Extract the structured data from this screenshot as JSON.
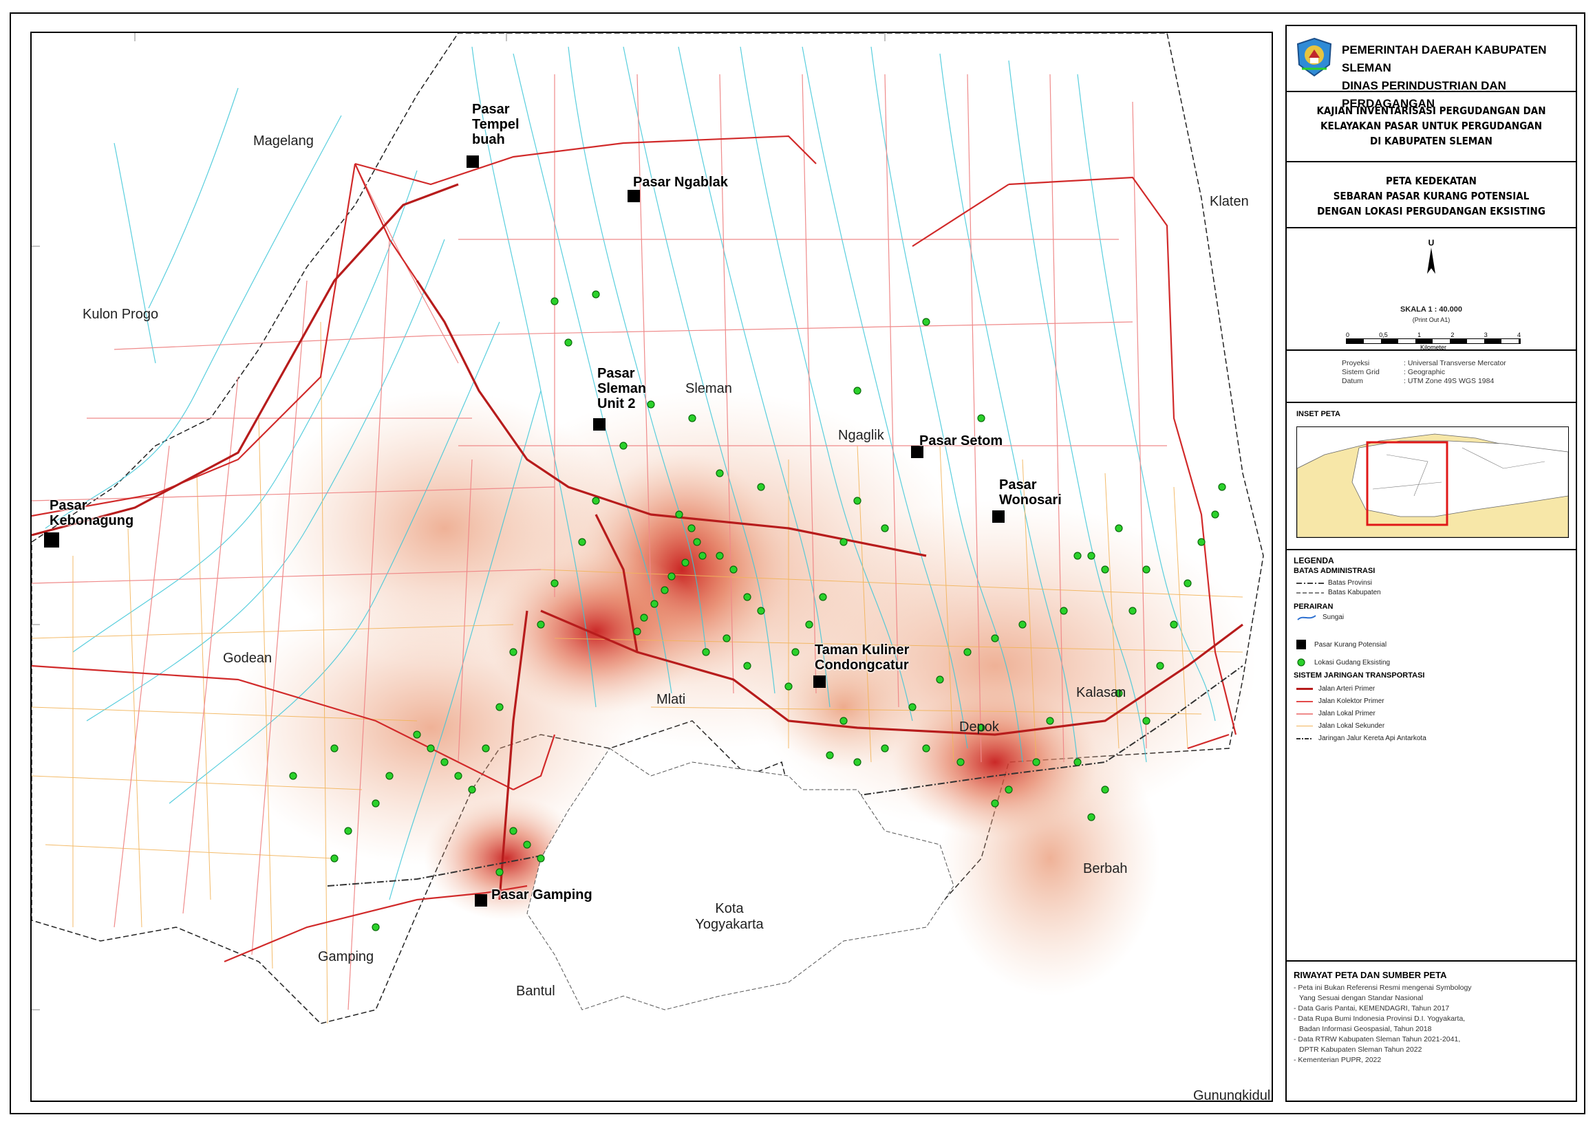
{
  "header": {
    "org_line1": "PEMERINTAH DAERAH KABUPATEN SLEMAN",
    "org_line2": "DINAS PERINDUSTRIAN DAN PERDAGANGAN",
    "study_line1": "KAJIAN INVENTARISASI PERGUDANGAN DAN",
    "study_line2": "KELAYAKAN PASAR UNTUK PERGUDANGAN",
    "study_line3": "DI KABUPATEN SLEMAN",
    "map_title1": "PETA KEDEKATAN",
    "map_title2": "SEBARAN PASAR KURANG POTENSIAL",
    "map_title3": "DENGAN LOKASI PERGUDANGAN EKSISTING"
  },
  "scale": {
    "north": "U",
    "label": "SKALA 1 : 40.000",
    "print": "(Print Out A1)",
    "ticks": [
      "0",
      "0,5",
      "1",
      "2",
      "3",
      "4"
    ],
    "unit": "Kilometer"
  },
  "projection": {
    "rows": [
      {
        "k": "Proyeksi",
        "v": ": Universal Transverse Mercator"
      },
      {
        "k": "Sistem Grid",
        "v": ": Geographic"
      },
      {
        "k": "Datum",
        "v": ": UTM Zone 49S WGS 1984"
      }
    ]
  },
  "inset": {
    "title": "INSET PETA"
  },
  "legend": {
    "title": "LEGENDA",
    "admin_title": "BATAS ADMINISTRASI",
    "batas_provinsi": "Batas Provinsi",
    "batas_kabupaten": "Batas Kabupaten",
    "perairan_title": "PERAIRAN",
    "sungai": "Sungai",
    "pasar": "Pasar Kurang Potensial",
    "gudang": "Lokasi Gudang Eksisting",
    "transport_title": "SISTEM JARINGAN TRANSPORTASI",
    "roads": [
      {
        "label": "Jalan Arteri Primer",
        "color": "#c0262c"
      },
      {
        "label": "Jalan Kolektor Primer",
        "color": "#e24a4a"
      },
      {
        "label": "Jalan Lokal Primer",
        "color": "#ef8a8a"
      },
      {
        "label": "Jalan Lokal Sekunder",
        "color": "#f2b45a"
      },
      {
        "label": "Jaringan Jalur Kereta Api Antarkota",
        "color": "#333333"
      }
    ]
  },
  "riwayat": {
    "title": "RIWAYAT PETA DAN SUMBER PETA",
    "lines": [
      "- Peta ini Bukan Referensi Resmi mengenai Symbology",
      "  Yang Sesuai dengan Standar Nasional",
      "- Data Garis Pantai, KEMENDAGRI, Tahun 2017",
      "- Data Rupa Bumi Indonesia Provinsi D.I. Yogyakarta,",
      "  Badan Informasi Geospasial, Tahun 2018",
      "- Data RTRW Kabupaten Sleman Tahun 2021-2041,",
      "  DPTR Kabupaten Sleman Tahun 2022",
      "- Kementerian PUPR, 2022"
    ]
  },
  "map": {
    "regions": [
      "Magelang",
      "Klaten",
      "Kulon Progo",
      "Godean",
      "Gamping",
      "Bantul",
      "Kota Yogyakarta",
      "Gunungkidul",
      "Sleman",
      "Ngaglik",
      "Mlati",
      "Depok",
      "Kalasan",
      "Berbah"
    ],
    "pasar": [
      "Pasar Tempel buah",
      "Pasar Ngablak",
      "Pasar Sleman Unit 2",
      "Pasar Setom",
      "Pasar Wonosari",
      "Pasar Kebonagung",
      "Taman Kuliner Condongcatur",
      "Pasar Gamping"
    ]
  }
}
